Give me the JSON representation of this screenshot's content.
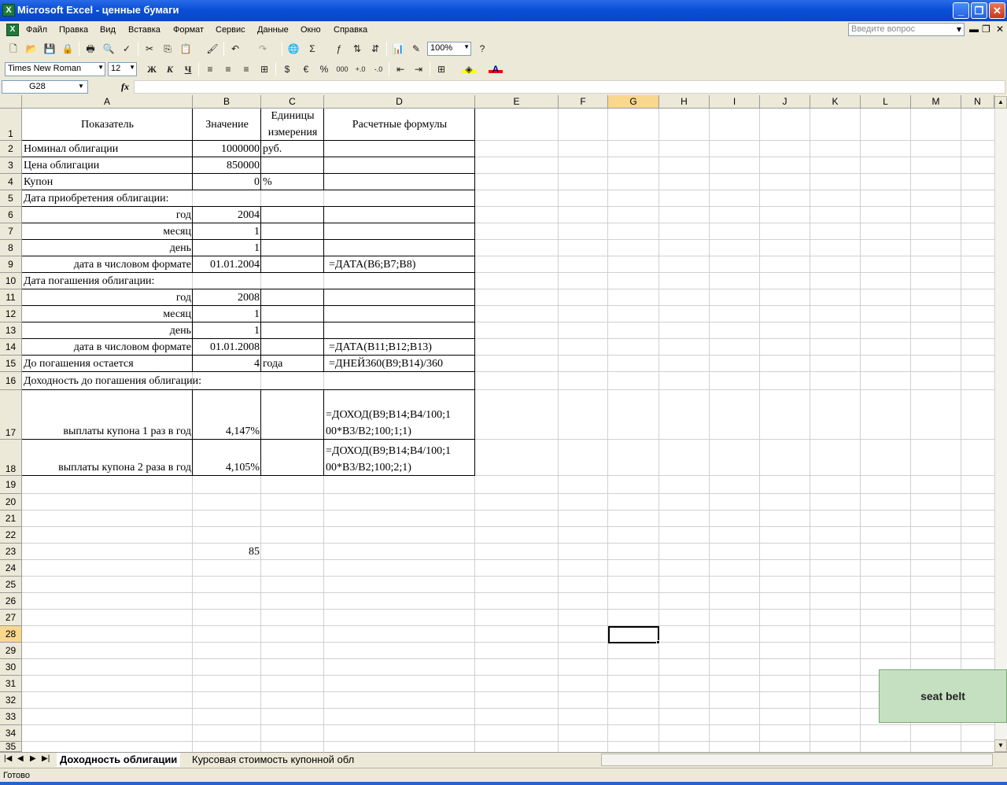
{
  "window": {
    "title": "Microsoft Excel - ценные бумаги",
    "controls": {
      "minimize": "_",
      "maximize": "❐",
      "close": "✕"
    }
  },
  "menu": {
    "items": [
      "Файл",
      "Правка",
      "Вид",
      "Вставка",
      "Формат",
      "Сервис",
      "Данные",
      "Окно",
      "Справка"
    ],
    "help_placeholder": "Введите вопрос"
  },
  "toolbar": {
    "zoom": "100%",
    "font_name": "Times New Roman",
    "font_size": "12",
    "bold": "Ж",
    "italic": "К",
    "underline": "Ч",
    "percent": "%",
    "euro": "€",
    "thousands": "000",
    "fill_color": "#ffff00",
    "font_color": "#ff0000"
  },
  "formula_bar": {
    "name_box": "G28",
    "fx": "fx",
    "value": ""
  },
  "columns": [
    "A",
    "B",
    "C",
    "D",
    "E",
    "F",
    "G",
    "H",
    "I",
    "J",
    "K",
    "L",
    "M",
    "N"
  ],
  "selected_column": "G",
  "selected_row": "28",
  "rows": [
    "1",
    "2",
    "3",
    "4",
    "5",
    "6",
    "7",
    "8",
    "9",
    "10",
    "11",
    "12",
    "13",
    "14",
    "15",
    "16",
    "17",
    "18",
    "19",
    "20",
    "21",
    "22",
    "23",
    "24",
    "25",
    "26",
    "27",
    "28",
    "29",
    "30",
    "31",
    "32",
    "33",
    "34",
    "35"
  ],
  "cells": {
    "A1": "Показатель",
    "B1": "Значение",
    "C1a": "Единицы",
    "C1b": "измерения",
    "D1": "Расчетные формулы",
    "A2": "Номинал облигации",
    "B2": "1000000",
    "C2": "руб.",
    "A3": "Цена облигации",
    "B3": "850000",
    "A4": "Купон",
    "B4": "0",
    "C4": "%",
    "A5": "Дата приобретения облигации:",
    "A6": "год",
    "B6": "2004",
    "A7": "месяц",
    "B7": "1",
    "A8": "день",
    "B8": "1",
    "A9": "дата в числовом формате",
    "B9": "01.01.2004",
    "D9": "=ДАТА(B6;B7;B8)",
    "A10": "Дата погашения облигации:",
    "A11": "год",
    "B11": "2008",
    "A12": "месяц",
    "B12": "1",
    "A13": "день",
    "B13": "1",
    "A14": "дата в числовом формате",
    "B14": "01.01.2008",
    "D14": "=ДАТА(B11;B12;B13)",
    "A15": "До погашения остается",
    "B15": "4",
    "C15": "года",
    "D15": "=ДНЕЙ360(B9;B14)/360",
    "A16": "Доходность до погашения облигации:",
    "A17": "выплаты купона 1 раз в год",
    "B17": "4,147%",
    "D17a": "=ДОХОД(B9;B14;B4/100;1",
    "D17b": "00*B3/B2;100;1;1)",
    "A18": "выплаты купона 2 раза в год",
    "B18": "4,105%",
    "D18a": "=ДОХОД(B9;B14;B4/100;1",
    "D18b": "00*B3/B2;100;2;1)",
    "B23": "85"
  },
  "sheets": [
    "Доходность облигации",
    "Курсовая стоимость купонной обл"
  ],
  "status": "Готово",
  "overlay_label": "seat belt"
}
